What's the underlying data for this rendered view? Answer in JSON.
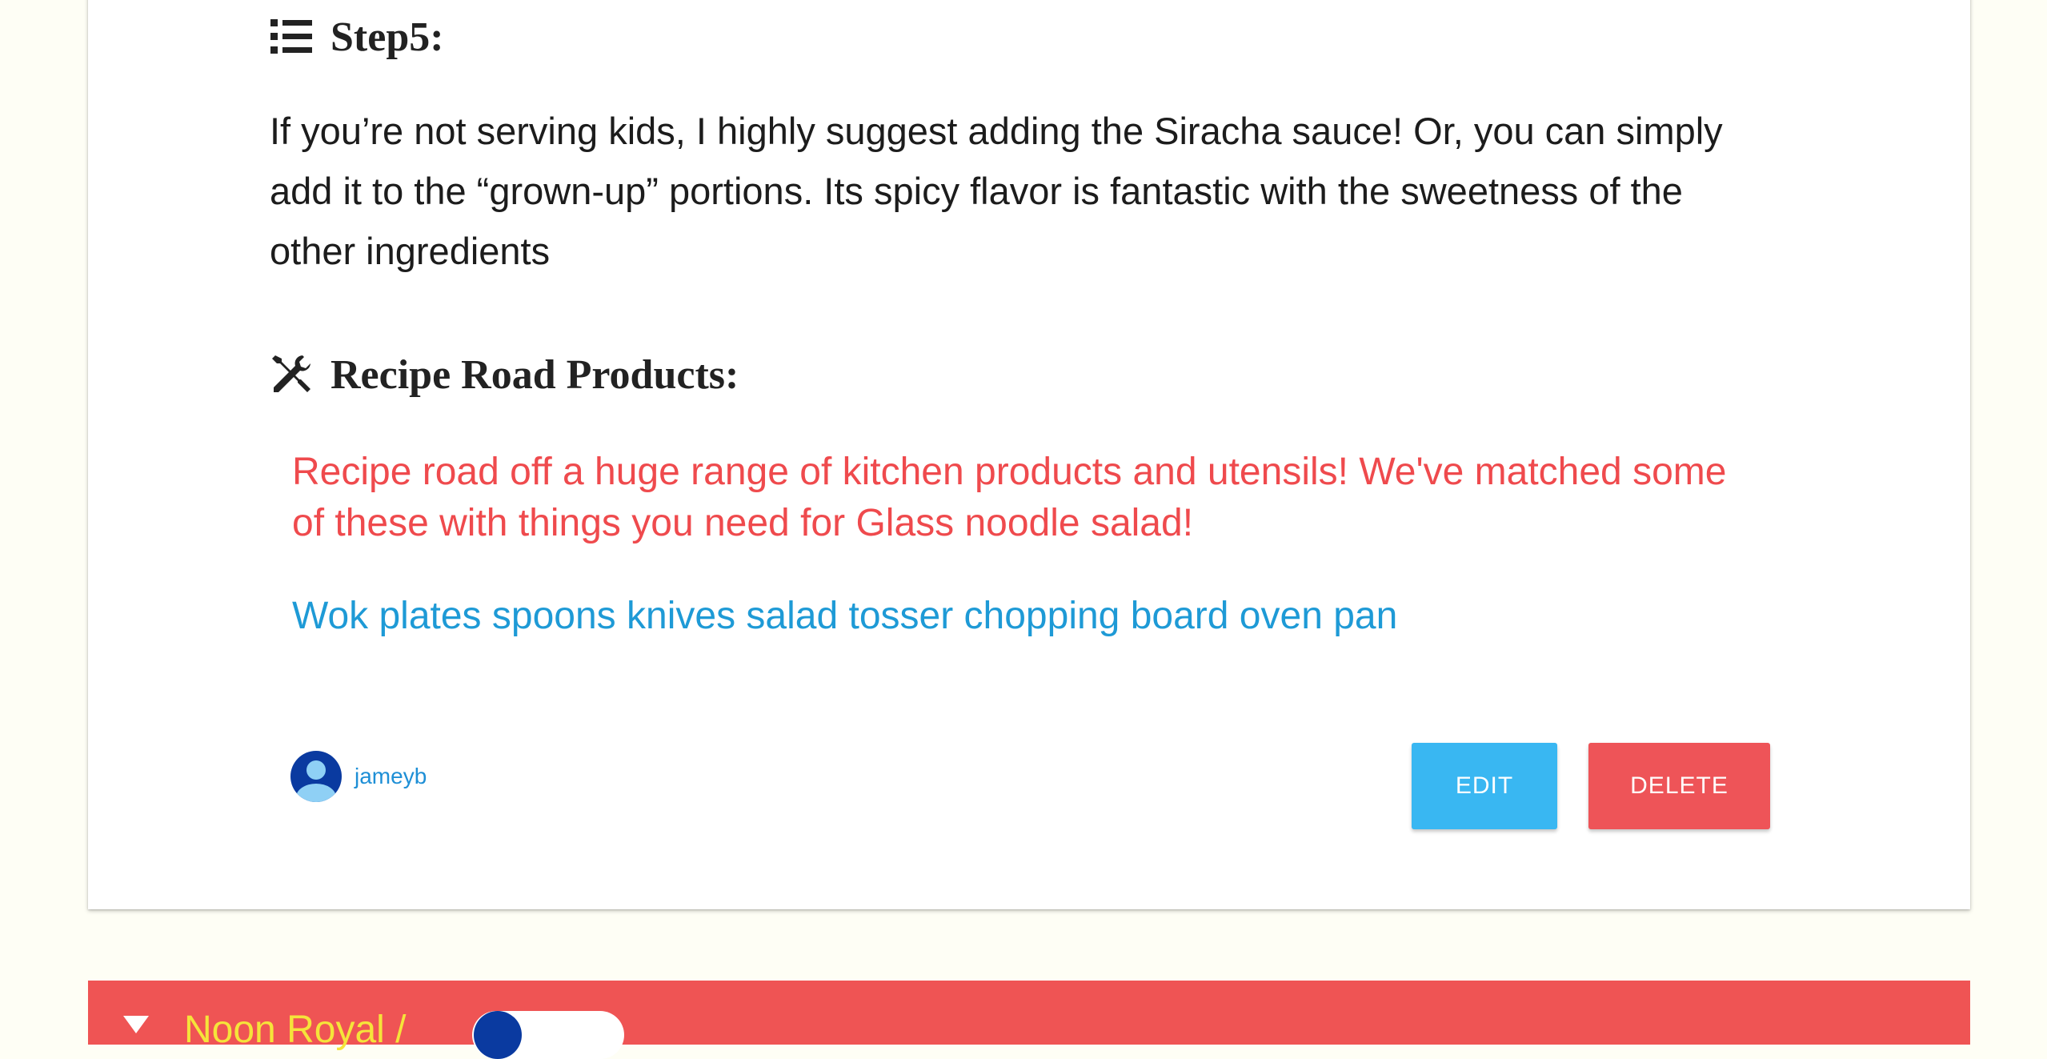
{
  "step": {
    "heading": "Step5:",
    "icon": "list-icon",
    "text": "If you’re not serving kids, I highly suggest adding the Siracha sauce! Or, you can simply add it to the “grown-up” portions. Its spicy flavor is fantastic with the sweetness of the other ingredients"
  },
  "products": {
    "heading": "Recipe Road Products:",
    "icon": "tools-icon",
    "intro": "Recipe road off a huge range of kitchen products and utensils! We've matched some of these with things you need for Glass noodle salad!",
    "list": "Wok plates spoons knives salad tosser chopping board oven pan"
  },
  "author": {
    "username": "jameyb",
    "icon": "user-avatar-icon"
  },
  "actions": {
    "edit_label": "EDIT",
    "delete_label": "DELETE"
  },
  "next_card": {
    "title": "Noon Royal /",
    "icon": "hourglass-icon"
  },
  "colors": {
    "background": "#fefef5",
    "accent_red": "#ef5454",
    "accent_blue": "#39b7f2",
    "link_blue": "#1e9ad6",
    "title_yellow": "#f5e43a"
  }
}
